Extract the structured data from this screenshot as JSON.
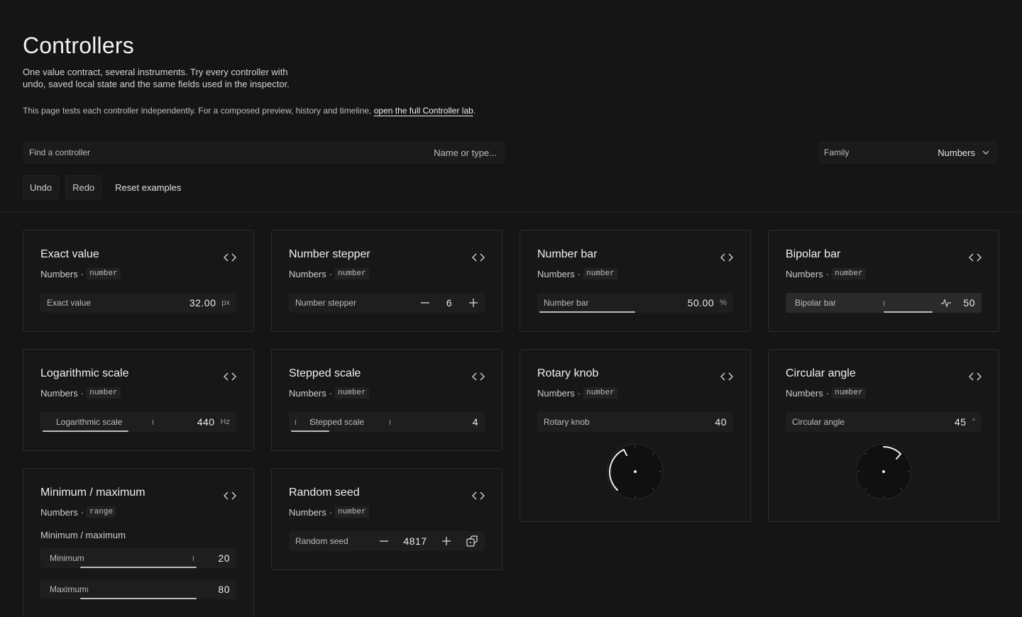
{
  "page": {
    "title": "Controllers",
    "subtitle": "One value contract, several instruments. Try every controller with undo, saved local state and the same fields used in the inspector.",
    "note_prefix": "This page tests each controller independently. For a composed preview, history and timeline, ",
    "note_link": "open the full Controller lab",
    "note_suffix": "."
  },
  "search": {
    "label": "Find a controller",
    "placeholder": "Name or type..."
  },
  "family": {
    "label": "Family",
    "value": "Numbers"
  },
  "actions": {
    "undo": "Undo",
    "redo": "Redo",
    "reset": "Reset examples"
  },
  "cards": {
    "exact": {
      "title": "Exact value",
      "family": "Numbers",
      "type": "number",
      "control_label": "Exact value",
      "value": "32.00",
      "unit": "px"
    },
    "stepper": {
      "title": "Number stepper",
      "family": "Numbers",
      "type": "number",
      "control_label": "Number stepper",
      "value": "6"
    },
    "numbar": {
      "title": "Number bar",
      "family": "Numbers",
      "type": "number",
      "control_label": "Number bar",
      "value": "50.00",
      "unit": "%",
      "fill_fraction": 0.5
    },
    "bipolar": {
      "title": "Bipolar bar",
      "family": "Numbers",
      "type": "number",
      "control_label": "Bipolar bar",
      "value": "50",
      "fill_fraction": 0.5
    },
    "log": {
      "title": "Logarithmic scale",
      "family": "Numbers",
      "type": "number",
      "control_label": "Logarithmic scale",
      "value": "440",
      "unit": "Hz"
    },
    "stepped": {
      "title": "Stepped scale",
      "family": "Numbers",
      "type": "number",
      "control_label": "Stepped scale",
      "value": "4"
    },
    "rotary": {
      "title": "Rotary knob",
      "family": "Numbers",
      "type": "number",
      "control_label": "Rotary knob",
      "value": "40"
    },
    "circular": {
      "title": "Circular angle",
      "family": "Numbers",
      "type": "number",
      "control_label": "Circular angle",
      "value": "45",
      "unit": "°"
    },
    "minmax": {
      "title": "Minimum / maximum",
      "family": "Numbers",
      "type": "range",
      "group_label": "Minimum / maximum",
      "min_label": "Minimum",
      "min_value": "20",
      "max_label": "Maximum",
      "max_value": "80"
    },
    "seed": {
      "title": "Random seed",
      "family": "Numbers",
      "type": "number",
      "control_label": "Random seed",
      "value": "4817"
    }
  },
  "icons": {
    "code": "code-brackets-icon",
    "chevron": "chevron-down-icon",
    "minus": "minus-icon",
    "plus": "plus-icon",
    "pulse": "pulse-icon",
    "dice": "dice-icon"
  },
  "colors": {
    "background": "#151515",
    "card": "#171717",
    "control": "#1e1e1e",
    "fill": "#bdbdbd"
  }
}
